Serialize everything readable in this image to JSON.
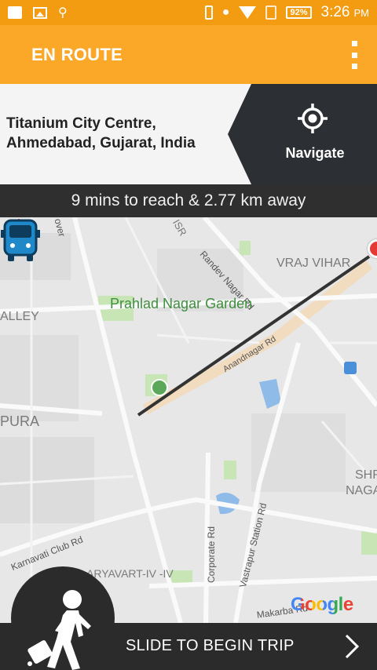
{
  "status_bar": {
    "battery": "92%",
    "time": "3:26",
    "ampm": "PM",
    "icons": [
      "notification-icon",
      "image-icon",
      "usb-icon",
      "phone-icon",
      "location-icon",
      "wifi-icon",
      "no-sim-icon",
      "battery-icon"
    ]
  },
  "app_bar": {
    "title": "EN ROUTE",
    "menu_icon": "overflow-menu-icon"
  },
  "destination": {
    "address": "Titanium City Centre, Ahmedabad, Gujarat, India",
    "navigate_label": "Navigate",
    "navigate_icon": "gps-target-icon"
  },
  "eta": {
    "text": "9 mins to reach & 2.77 km away"
  },
  "map": {
    "labels": {
      "isr": "ISR",
      "grover": "over",
      "vraj_vihar": "VRAJ VIHAR",
      "randev": "Randev Nagar Rd",
      "prahlad": "Prahlad Nagar Garden",
      "alley": "ALLEY",
      "anand": "Anandnagar Rd",
      "pura": "PURA",
      "shr": "SHR",
      "naga": "NAGA",
      "karnavati": "Karnavati Club Rd",
      "aryavart": "ARYAVART-IV -IV",
      "corporate": "Corporate Rd",
      "vastrapur": "Vastrapur Station Rd",
      "makarba": "Makarba Rd"
    },
    "attribution": "Google",
    "colors": {
      "route": "#333333",
      "parks": "#c8e6b5",
      "water": "#7fb2e5"
    }
  },
  "bottom_bar": {
    "slide_label": "SLIDE TO BEGIN TRIP",
    "walker_icon": "walking-with-luggage-icon",
    "arrow_icon": "chevron-right-icon"
  },
  "colors": {
    "accent": "#fba728",
    "status_bar": "#f39c12",
    "dark": "#2c2f33"
  }
}
